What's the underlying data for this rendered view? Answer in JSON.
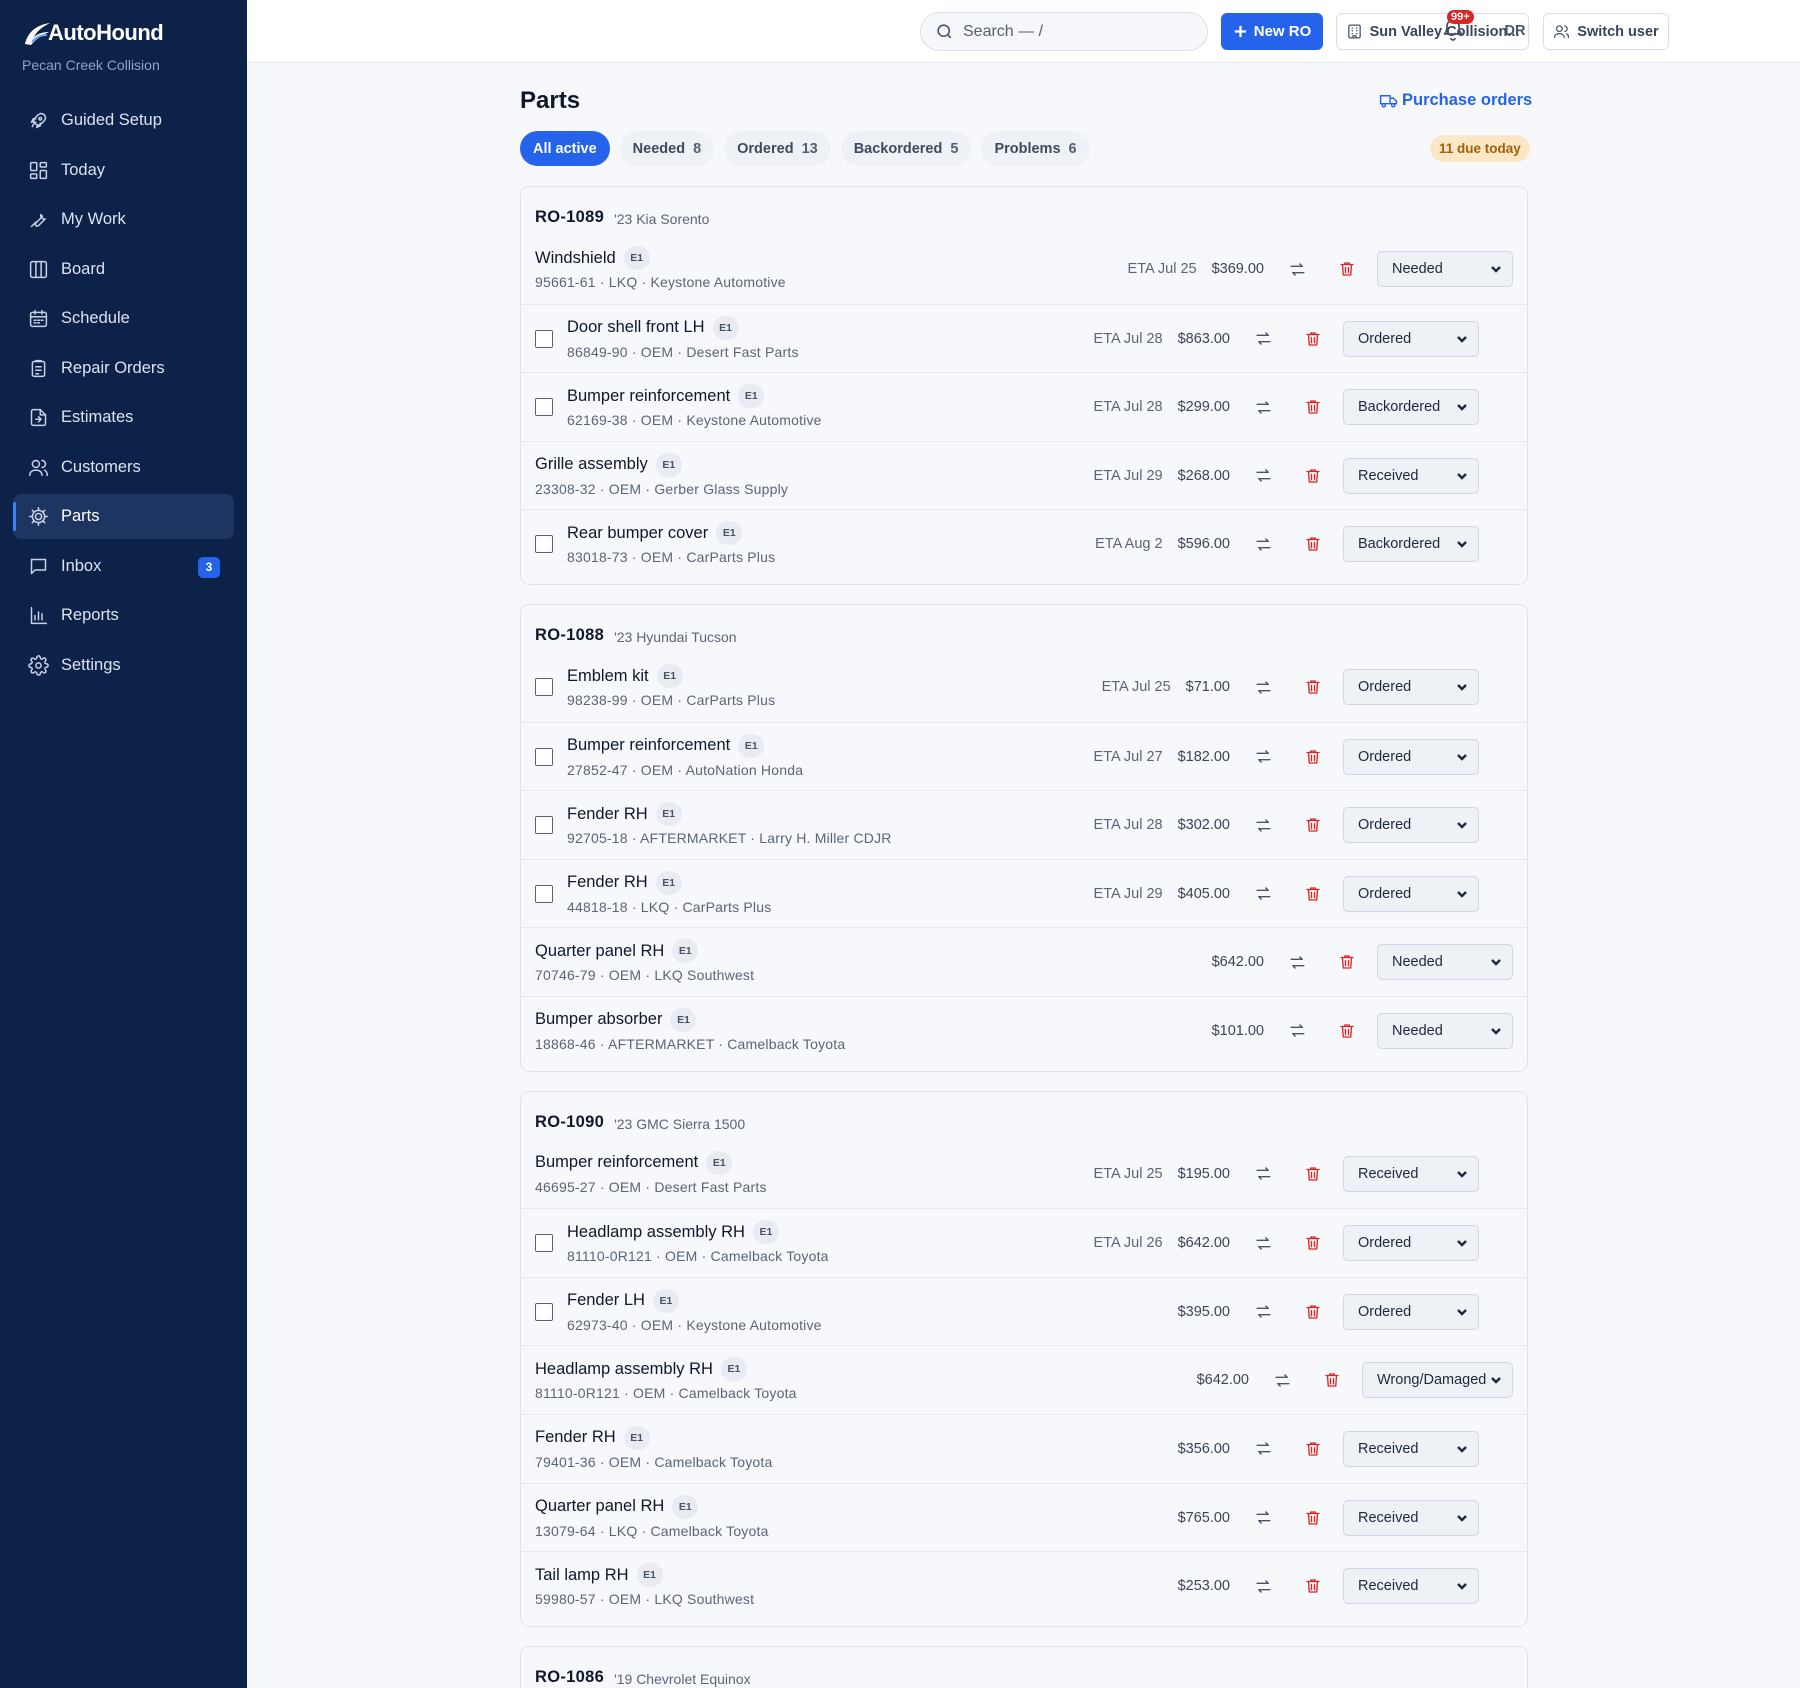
{
  "brand": {
    "name": "AutoHound",
    "shop": "Pecan Creek Collision"
  },
  "nav": [
    {
      "label": "Guided Setup",
      "icon": "rocket-icon"
    },
    {
      "label": "Today",
      "icon": "dashboard-icon"
    },
    {
      "label": "My Work",
      "icon": "wrench-icon"
    },
    {
      "label": "Board",
      "icon": "columns-icon"
    },
    {
      "label": "Schedule",
      "icon": "calendar-icon"
    },
    {
      "label": "Repair Orders",
      "icon": "clipboard-icon"
    },
    {
      "label": "Estimates",
      "icon": "file-icon"
    },
    {
      "label": "Customers",
      "icon": "users-icon"
    },
    {
      "label": "Parts",
      "icon": "cog-icon",
      "active": true
    },
    {
      "label": "Inbox",
      "icon": "message-icon",
      "badge": "3"
    },
    {
      "label": "Reports",
      "icon": "bar-chart-icon"
    },
    {
      "label": "Settings",
      "icon": "settings-icon"
    }
  ],
  "topbar": {
    "search_placeholder": "Search — /",
    "new_ro": "New RO",
    "shop_switch": "Sun Valley Collision...",
    "switch_user": "Switch user",
    "notifications": "99+",
    "avatar": "DR"
  },
  "page": {
    "title": "Parts",
    "purchase_orders": "Purchase orders",
    "due_today": "11 due today"
  },
  "filters": [
    {
      "label": "All active",
      "count": "",
      "active": true
    },
    {
      "label": "Needed",
      "count": "8"
    },
    {
      "label": "Ordered",
      "count": "13"
    },
    {
      "label": "Backordered",
      "count": "5"
    },
    {
      "label": "Problems",
      "count": "6"
    }
  ],
  "groups": [
    {
      "ro": "RO-1089",
      "vehicle": "'23 Kia Sorento",
      "parts": [
        {
          "name": "Windshield",
          "tag": "E1",
          "sub": "95661-61 · LKQ · Keystone Automotive",
          "eta": "ETA Jul 25",
          "price": "$369.00",
          "status": "Needed",
          "checkbox": false
        },
        {
          "name": "Door shell front LH",
          "tag": "E1",
          "sub": "86849-90 · OEM · Desert Fast Parts",
          "eta": "ETA Jul 28",
          "price": "$863.00",
          "status": "Ordered",
          "checkbox": true
        },
        {
          "name": "Bumper reinforcement",
          "tag": "E1",
          "sub": "62169-38 · OEM · Keystone Automotive",
          "eta": "ETA Jul 28",
          "price": "$299.00",
          "status": "Backordered",
          "checkbox": true
        },
        {
          "name": "Grille assembly",
          "tag": "E1",
          "sub": "23308-32 · OEM · Gerber Glass Supply",
          "eta": "ETA Jul 29",
          "price": "$268.00",
          "status": "Received",
          "checkbox": false
        },
        {
          "name": "Rear bumper cover",
          "tag": "E1",
          "sub": "83018-73 · OEM · CarParts Plus",
          "eta": "ETA Aug 2",
          "price": "$596.00",
          "status": "Backordered",
          "checkbox": true
        }
      ]
    },
    {
      "ro": "RO-1088",
      "vehicle": "'23 Hyundai Tucson",
      "parts": [
        {
          "name": "Emblem kit",
          "tag": "E1",
          "sub": "98238-99 · OEM · CarParts Plus",
          "eta": "ETA Jul 25",
          "price": "$71.00",
          "status": "Ordered",
          "checkbox": true
        },
        {
          "name": "Bumper reinforcement",
          "tag": "E1",
          "sub": "27852-47 · OEM · AutoNation Honda",
          "eta": "ETA Jul 27",
          "price": "$182.00",
          "status": "Ordered",
          "checkbox": true
        },
        {
          "name": "Fender RH",
          "tag": "E1",
          "sub": "92705-18 · AFTERMARKET · Larry H. Miller CDJR",
          "eta": "ETA Jul 28",
          "price": "$302.00",
          "status": "Ordered",
          "checkbox": true
        },
        {
          "name": "Fender RH",
          "tag": "E1",
          "sub": "44818-18 · LKQ · CarParts Plus",
          "eta": "ETA Jul 29",
          "price": "$405.00",
          "status": "Ordered",
          "checkbox": true
        },
        {
          "name": "Quarter panel RH",
          "tag": "E1",
          "sub": "70746-79 · OEM · LKQ Southwest",
          "eta": "",
          "price": "$642.00",
          "status": "Needed",
          "checkbox": false
        },
        {
          "name": "Bumper absorber",
          "tag": "E1",
          "sub": "18868-46 · AFTERMARKET · Camelback Toyota",
          "eta": "",
          "price": "$101.00",
          "status": "Needed",
          "checkbox": false
        }
      ]
    },
    {
      "ro": "RO-1090",
      "vehicle": "'23 GMC Sierra 1500",
      "parts": [
        {
          "name": "Bumper reinforcement",
          "tag": "E1",
          "sub": "46695-27 · OEM · Desert Fast Parts",
          "eta": "ETA Jul 25",
          "price": "$195.00",
          "status": "Received",
          "checkbox": false
        },
        {
          "name": "Headlamp assembly RH",
          "tag": "E1",
          "sub": "81110-0R121 · OEM · Camelback Toyota",
          "eta": "ETA Jul 26",
          "price": "$642.00",
          "status": "Ordered",
          "checkbox": true
        },
        {
          "name": "Fender LH",
          "tag": "E1",
          "sub": "62973-40 · OEM · Keystone Automotive",
          "eta": "",
          "price": "$395.00",
          "status": "Ordered",
          "checkbox": true
        },
        {
          "name": "Headlamp assembly RH",
          "tag": "E1",
          "sub": "81110-0R121 · OEM · Camelback Toyota",
          "eta": "",
          "price": "$642.00",
          "status": "Wrong/Damaged",
          "checkbox": false
        },
        {
          "name": "Fender RH",
          "tag": "E1",
          "sub": "79401-36 · OEM · Camelback Toyota",
          "eta": "",
          "price": "$356.00",
          "status": "Received",
          "checkbox": false
        },
        {
          "name": "Quarter panel RH",
          "tag": "E1",
          "sub": "13079-64 · LKQ · Camelback Toyota",
          "eta": "",
          "price": "$765.00",
          "status": "Received",
          "checkbox": false
        },
        {
          "name": "Tail lamp RH",
          "tag": "E1",
          "sub": "59980-57 · OEM · LKQ Southwest",
          "eta": "",
          "price": "$253.00",
          "status": "Received",
          "checkbox": false
        }
      ]
    },
    {
      "ro": "RO-1086",
      "vehicle": "'19 Chevrolet Equinox",
      "parts": []
    }
  ]
}
